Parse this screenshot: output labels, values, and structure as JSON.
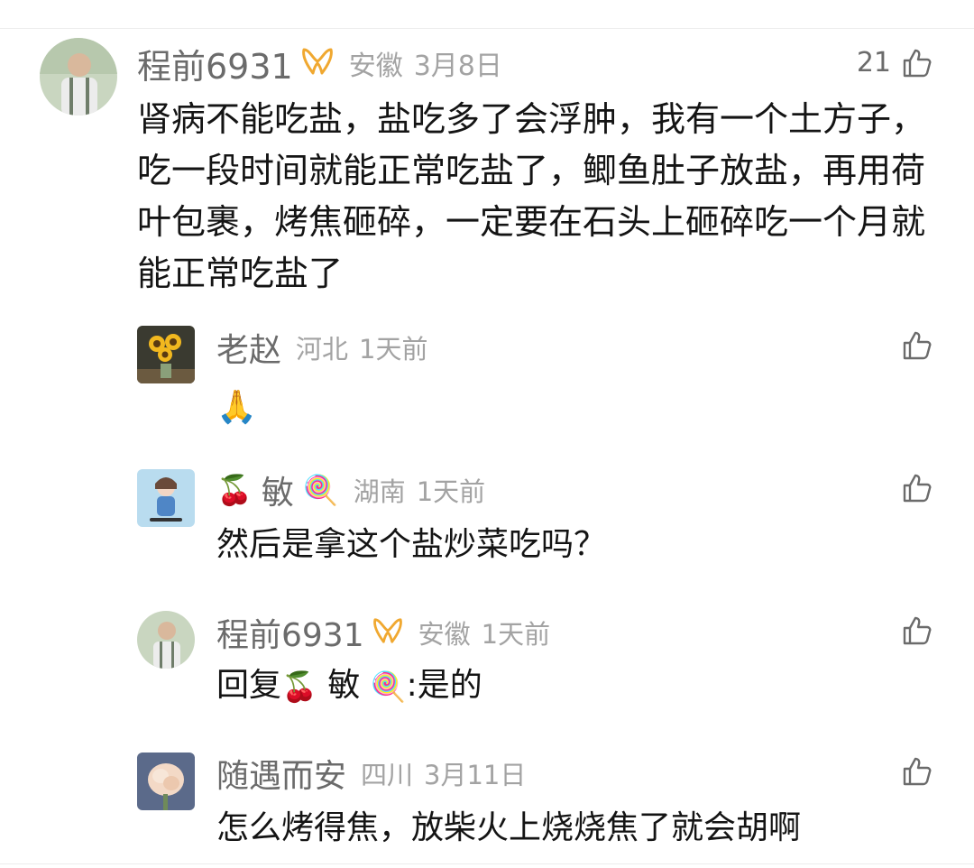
{
  "comment": {
    "username": "程前6931",
    "region": "安徽",
    "time": "3月8日",
    "like_count": "21",
    "text": "肾病不能吃盐，盐吃多了会浮肿，我有一个土方子，吃一段时间就能正常吃盐了，鲫鱼肚子放盐，再用荷叶包裹，烤焦砸碎，一定要在石头上砸碎吃一个月就能正常吃盐了",
    "icons": {
      "vip": "vip-badge-icon",
      "like": "thumbs-up-icon"
    }
  },
  "replies": [
    {
      "username": "老赵",
      "region": "河北",
      "time": "1天前",
      "emoji": "🙏"
    },
    {
      "username": "敏",
      "region": "湖南",
      "time": "1天前",
      "text": "然后是拿这个盐炒菜吃吗？",
      "name_prefix_emoji": "🍒",
      "name_suffix_emoji": "🍭"
    },
    {
      "username": "程前6931",
      "region": "安徽",
      "time": "1天前",
      "reply_prefix": "回复",
      "reply_to": "敏",
      "reply_text": ":是的"
    },
    {
      "username": "随遇而安",
      "region": "四川",
      "time": "3月11日",
      "text": "怎么烤得焦，放柴火上烧烧焦了就会胡啊"
    }
  ],
  "colors": {
    "username": "#6b6b6b",
    "meta": "#a3a3a3",
    "text": "#141414",
    "vip_gold": "#f0a830"
  }
}
